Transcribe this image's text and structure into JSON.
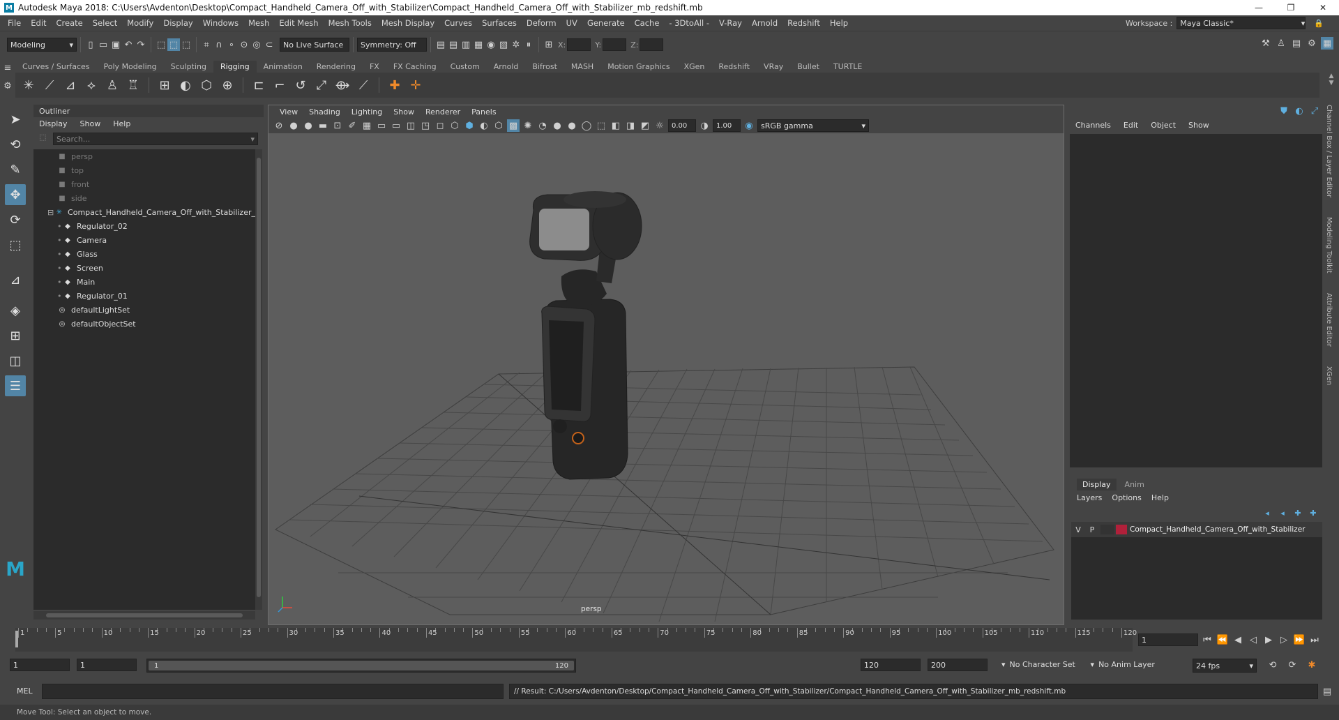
{
  "window": {
    "title": "Autodesk Maya 2018: C:\\Users\\Avdenton\\Desktop\\Compact_Handheld_Camera_Off_with_Stabilizer\\Compact_Handheld_Camera_Off_with_Stabilizer_mb_redshift.mb",
    "logo": "M",
    "minimize": "—",
    "maximize": "❐",
    "close": "✕"
  },
  "menubar": {
    "items": [
      "File",
      "Edit",
      "Create",
      "Select",
      "Modify",
      "Display",
      "Windows",
      "Mesh",
      "Edit Mesh",
      "Mesh Tools",
      "Mesh Display",
      "Curves",
      "Surfaces",
      "Deform",
      "UV",
      "Generate",
      "Cache",
      "- 3DtoAll -",
      "V-Ray",
      "Arnold",
      "Redshift",
      "Help"
    ],
    "workspace_label": "Workspace :",
    "workspace_value": "Maya Classic*"
  },
  "statusline": {
    "mode": "Modeling",
    "live_surface": "No Live Surface",
    "symmetry": "Symmetry: Off",
    "x_label": "X:",
    "y_label": "Y:",
    "z_label": "Z:"
  },
  "shelf": {
    "tabs": [
      "Curves / Surfaces",
      "Poly Modeling",
      "Sculpting",
      "Rigging",
      "Animation",
      "Rendering",
      "FX",
      "FX Caching",
      "Custom",
      "Arnold",
      "Bifrost",
      "MASH",
      "Motion Graphics",
      "XGen",
      "Redshift",
      "VRay",
      "Bullet",
      "TURTLE"
    ],
    "active_tab": "Rigging"
  },
  "outliner": {
    "title": "Outliner",
    "menus": [
      "Display",
      "Show",
      "Help"
    ],
    "search_placeholder": "Search...",
    "cameras": [
      "persp",
      "top",
      "front",
      "side"
    ],
    "group": "Compact_Handheld_Camera_Off_with_Stabilizer_",
    "children": [
      "Regulator_02",
      "Camera",
      "Glass",
      "Screen",
      "Main",
      "Regulator_01"
    ],
    "sets": [
      "defaultLightSet",
      "defaultObjectSet"
    ]
  },
  "viewport": {
    "menus": [
      "View",
      "Shading",
      "Lighting",
      "Show",
      "Renderer",
      "Panels"
    ],
    "exposure": "0.00",
    "gamma": "1.00",
    "color_space": "sRGB gamma",
    "camera_label": "persp"
  },
  "channelbox": {
    "menus": [
      "Channels",
      "Edit",
      "Object",
      "Show"
    ]
  },
  "layers": {
    "tabs": [
      "Display",
      "Anim"
    ],
    "active_tab": "Display",
    "menus": [
      "Layers",
      "Options",
      "Help"
    ],
    "layer": {
      "v": "V",
      "p": "P",
      "name": "Compact_Handheld_Camera_Off_with_Stabilizer",
      "color": "#b0203a"
    }
  },
  "side_tabs": [
    "Channel Box / Layer Editor",
    "Modeling Toolkit",
    "Attribute Editor",
    "XGen"
  ],
  "timeslider": {
    "ticks": [
      "5",
      "10",
      "15",
      "20",
      "25",
      "30",
      "35",
      "40",
      "45",
      "50",
      "55",
      "60",
      "65",
      "70",
      "75",
      "80",
      "85",
      "90",
      "95",
      "100",
      "105",
      "110",
      "115",
      "120"
    ],
    "start_tick": "1",
    "current_frame": "1"
  },
  "range": {
    "start": "1",
    "playback_start": "1",
    "slider_start": "1",
    "slider_end": "120",
    "playback_end": "120",
    "end": "200",
    "character_set": "No Character Set",
    "anim_layer": "No Anim Layer",
    "fps": "24 fps"
  },
  "cmdline": {
    "lang": "MEL",
    "result": "// Result: C:/Users/Avdenton/Desktop/Compact_Handheld_Camera_Off_with_Stabilizer/Compact_Handheld_Camera_Off_with_Stabilizer_mb_redshift.mb"
  },
  "helpline": "Move Tool: Select an object to move.",
  "colors": {
    "accent": "#5285a6",
    "panel": "#444444",
    "field": "#2b2b2b",
    "viewport": "#5d5d5d"
  }
}
